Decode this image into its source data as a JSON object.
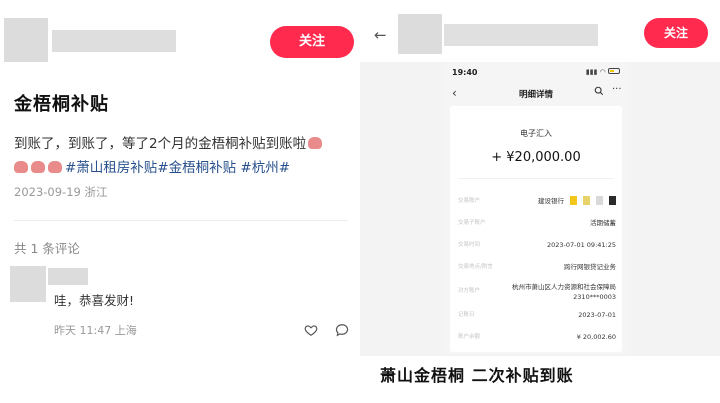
{
  "left": {
    "follow_label": "关注",
    "post_title": "金梧桐补贴",
    "post_text": "到账了，到账了，等了2个月的金梧桐补贴到账啦",
    "tags": [
      "#萧山租房补贴",
      "#金梧桐补贴",
      "#杭州",
      "#"
    ],
    "post_date": "2023-09-19",
    "post_location": "浙江",
    "comment_count": "共 1 条评论",
    "comment": {
      "text": "哇，恭喜发财!",
      "time": "昨天 11:47",
      "location": "上海"
    }
  },
  "right": {
    "follow_label": "关注",
    "phone": {
      "time": "19:40",
      "title": "明细详情",
      "label": "电子汇入",
      "amount": "+ ¥20,000.00",
      "rows": [
        {
          "key": "交易账户",
          "value": "建设银行"
        },
        {
          "key": "交易子账户",
          "value": "活期储蓄"
        },
        {
          "key": "交易时间",
          "value": "2023-07-01 09:41:25"
        },
        {
          "key": "交易地点/附言",
          "value": "跨行网银贷记业务"
        },
        {
          "key": "对方账户",
          "value": "杭州市萧山区人力资源和社会保障局 2310***0003"
        },
        {
          "key": "记账日",
          "value": "2023-07-01"
        },
        {
          "key": "账户余额",
          "value": "¥ 20,002.60"
        }
      ]
    },
    "caption": "萧山金梧桐 二次补贴到账"
  },
  "colors": {
    "accent": "#ff2a4d",
    "tag": "#274f8c"
  }
}
